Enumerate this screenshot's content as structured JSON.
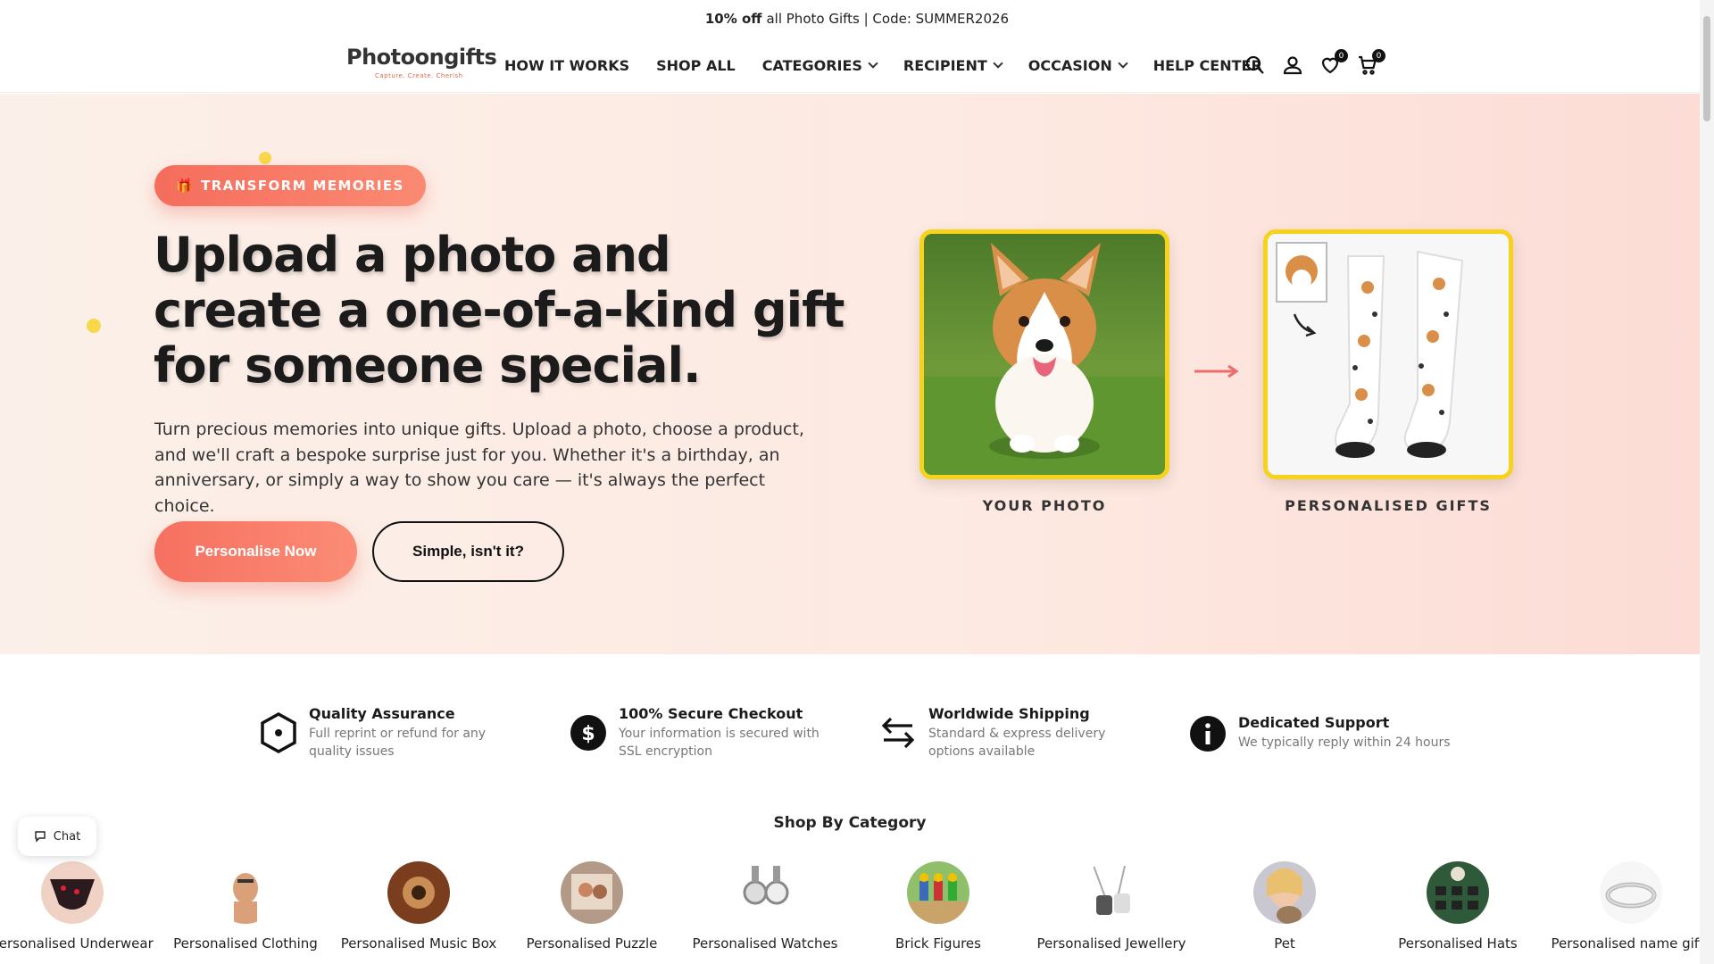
{
  "announcement": {
    "bold": "10% off",
    "text": "all Photo Gifts | Code: SUMMER2026"
  },
  "logo": {
    "text": "Photoongifts",
    "tagline": "Capture. Create. Cherish"
  },
  "nav": [
    {
      "label": "HOW IT WORKS",
      "dropdown": false
    },
    {
      "label": "SHOP ALL",
      "dropdown": false
    },
    {
      "label": "CATEGORIES",
      "dropdown": true
    },
    {
      "label": "RECIPIENT",
      "dropdown": true
    },
    {
      "label": "OCCASION",
      "dropdown": true
    },
    {
      "label": "HELP CENTER",
      "dropdown": false
    }
  ],
  "header_icons": {
    "wishlist_count": "0",
    "cart_count": "0"
  },
  "hero": {
    "pill": "TRANSFORM MEMORIES",
    "pill_icon": "🎁",
    "title": "Upload a photo and create a one-of-a-kind gift for someone special.",
    "description": "Turn precious memories into unique gifts. Upload a photo, choose a product, and we'll craft a bespoke surprise just for you. Whether it's a birthday, an anniversary, or simply a way to show you care — it's always the perfect choice.",
    "primary_button": "Personalise Now",
    "secondary_button": "Simple, isn't it?",
    "caption_left": "YOUR PHOTO",
    "caption_right": "PERSONALISED GIFTS"
  },
  "features": [
    {
      "title": "Quality Assurance",
      "desc": "Full reprint or refund for any quality issues",
      "icon": "shield-icon"
    },
    {
      "title": "100% Secure Checkout",
      "desc": "Your information is secured with SSL encryption",
      "icon": "dollar-icon"
    },
    {
      "title": "Worldwide Shipping",
      "desc": "Standard & express delivery options available",
      "icon": "arrows-icon"
    },
    {
      "title": "Dedicated Support",
      "desc": "We typically reply within 24 hours",
      "icon": "info-icon"
    }
  ],
  "category_title": "Shop By Category",
  "categories": [
    "Personalised Underwear",
    "Personalised Clothing",
    "Personalised Music Box",
    "Personalised Puzzle",
    "Personalised Watches",
    "Brick Figures",
    "Personalised Jewellery",
    "Pet",
    "Personalised Hats",
    "Personalised name gifts"
  ],
  "chat": {
    "label": "Chat"
  },
  "colors": {
    "accent": "#f56d5c",
    "frame": "#f6d21a",
    "hero_bg": "#fde9e1"
  }
}
